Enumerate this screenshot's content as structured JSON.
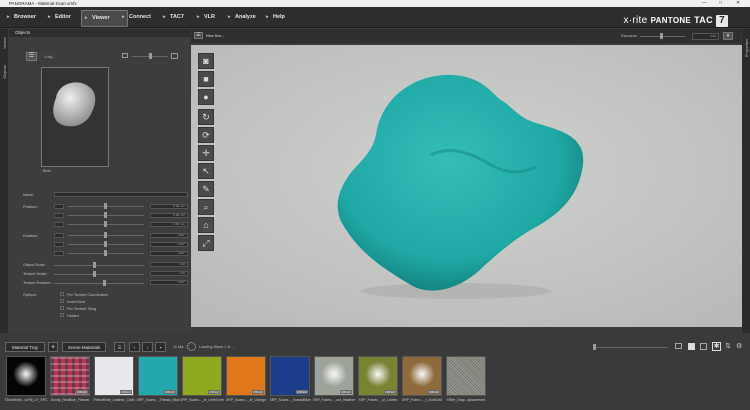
{
  "window": {
    "title": "PANORAMA - Material-Scan.vmfx",
    "controls": [
      "—",
      "□",
      "✕"
    ]
  },
  "menu": {
    "items": [
      {
        "label": "Browser",
        "active": false
      },
      {
        "label": "Editor",
        "active": false
      },
      {
        "label": "Viewer",
        "active": true
      },
      {
        "label": "Connect",
        "active": false
      },
      {
        "label": "TAC7",
        "active": false
      },
      {
        "label": "VLR",
        "active": false
      },
      {
        "label": "Analyze",
        "active": false
      },
      {
        "label": "Help",
        "active": false
      }
    ],
    "brand": {
      "xrite": "x·rite",
      "pantone": "PANTONE",
      "tac": "TAC",
      "seven": "7"
    }
  },
  "side": {
    "left_tabs": [
      "Viewer",
      "Objects"
    ],
    "right_tab": "Properties"
  },
  "objects_panel": {
    "header": "Objects",
    "list_label": "1 obj...",
    "thumb_label": "Blob",
    "name_label": "Name:",
    "position_label": "Position:",
    "rotation_label": "Rotation:",
    "object_scale_label": "Object Scale:",
    "texture_scale_label": "Texture Scale:",
    "texture_rotation_label": "Texture Rotation:",
    "options_label": "Options:",
    "position_values": [
      "0.00 mm",
      "0.00 mm",
      "0.00 mm"
    ],
    "rotation_values": [
      "0.00°",
      "0.00°",
      "0.00°"
    ],
    "object_scale_value": "1.00",
    "texture_scale_value": "1.00",
    "texture_rotation_value": "0.00°",
    "options": [
      "Per Texture Coordinates",
      "Invert Mod",
      "Per Texture Tiling",
      "Hidden"
    ]
  },
  "viewport": {
    "tab_label": "New Sce...",
    "exposure_label": "Exposure",
    "exposure_value": "0.00",
    "tools": [
      "camera-icon",
      "square-icon",
      "circle-icon",
      "refresh-icon",
      "rotate-icon",
      "move-icon",
      "pointer-icon",
      "pin-icon",
      "zoom-icon",
      "home-icon",
      "fit-icon"
    ],
    "object_color": "#1ea9a6",
    "background_color": "#c5c7c5"
  },
  "tray": {
    "material_tray_label": "Material Tray",
    "scene_materials_label": "Scene Materials",
    "count_label": "11 Ma...",
    "loading_text": "Loading Stack 1 of ...",
    "materials": [
      {
        "label": "TBonWhite...w.Fill_LF_SPC",
        "badge": "",
        "color": "#050508",
        "kind": "spot"
      },
      {
        "label": "Scotty_RedBlue_Flannel",
        "badge": "VMFEX",
        "color": "#b23a4a",
        "kind": "plaid"
      },
      {
        "label": "FiltecWhite_Leather_Cloth",
        "badge": "VMFEX",
        "color": "#e8e8ec",
        "kind": "plain"
      },
      {
        "label": "XRP_Scans..._Plastic_Blue",
        "badge": "VMFEX",
        "color": "#22a8ad",
        "kind": "plain"
      },
      {
        "label": "XRP_Scans..._le_LimeGreen",
        "badge": "VMFEX",
        "color": "#8faa21",
        "kind": "plain"
      },
      {
        "label": "XRP_Scans..._le_Orange",
        "badge": "VMFEX",
        "color": "#e0781a",
        "kind": "plain"
      },
      {
        "label": "XRP_Scans..._boeuklBlue",
        "badge": "VMFEX",
        "color": "#1c3e8a",
        "kind": "plain"
      },
      {
        "label": "XRP_Fabric..._cut_Heather",
        "badge": "VMFEX",
        "color": "#9ea39a",
        "kind": "spot"
      },
      {
        "label": "XRP_Fabric..._ut_Lichen",
        "badge": "VMFEX",
        "color": "#7a8234",
        "kind": "spot"
      },
      {
        "label": "XRP_Fabric..._t_SoftGold",
        "badge": "VMFEX",
        "color": "#8e6a3c",
        "kind": "spot"
      },
      {
        "label": "XRite_Gray...splacement",
        "badge": "",
        "color": "#8a8a86",
        "kind": "noise"
      }
    ]
  }
}
